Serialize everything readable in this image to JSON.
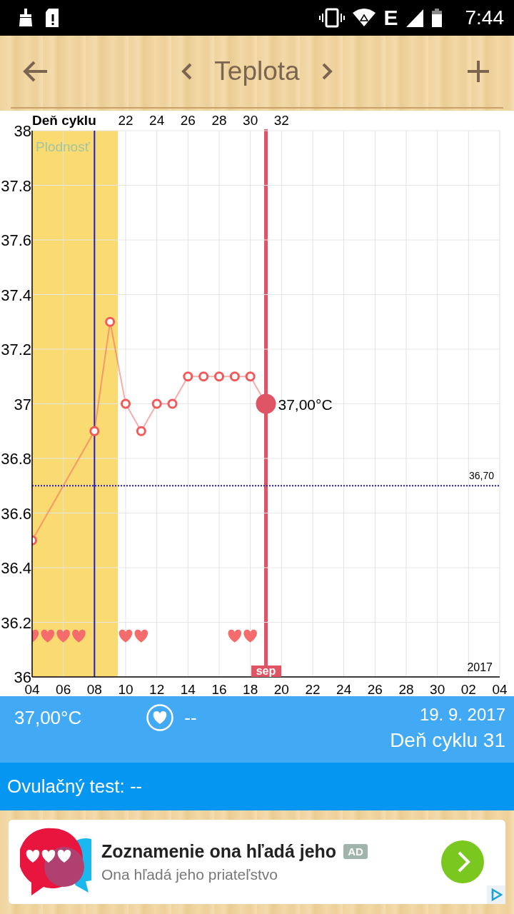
{
  "status_bar": {
    "network": "E",
    "time": "7:44"
  },
  "header": {
    "title": "Teplota"
  },
  "chart": {
    "cycle_axis_title": "Deň cyklu",
    "fertility_label": "Plodnosť",
    "year": "2017",
    "month": "sep",
    "cycle_labels": [
      "22",
      "24",
      "26",
      "28",
      "30",
      "32"
    ],
    "chart_data": {
      "type": "line",
      "grid": true,
      "categories": [
        "04",
        null,
        "06",
        null,
        "08",
        null,
        "10",
        null,
        "12",
        null,
        "14",
        null,
        "16",
        null,
        "18",
        null,
        "20",
        null,
        "22",
        null,
        "24",
        null,
        "26",
        null,
        "28",
        null,
        "30",
        null,
        "02",
        null,
        "04"
      ],
      "series": [
        {
          "color": "#f25a5a",
          "marker": "circle",
          "values": [
            36.5,
            null,
            null,
            null,
            36.9,
            37.3,
            37.0,
            36.9,
            37.0,
            37.0,
            37.1,
            37.1,
            37.1,
            37.1,
            37.1,
            37.0,
            null,
            null,
            null,
            null,
            null,
            null,
            null,
            null,
            null,
            null,
            null,
            null,
            null,
            null,
            null
          ]
        },
        {
          "type": "scatter",
          "color": "#f56c6c",
          "values": [
            36.15,
            36.15,
            36.15,
            36.15,
            null,
            null,
            36.15,
            36.15,
            null,
            null,
            null,
            null,
            null,
            36.15,
            36.15,
            null,
            null,
            null,
            null,
            null,
            null,
            null,
            null,
            null,
            null,
            null,
            null,
            null,
            null,
            null,
            null
          ]
        }
      ],
      "ylim": [
        36,
        38
      ],
      "yticks": [
        36,
        36.2,
        36.4,
        36.6,
        36.8,
        37,
        37.2,
        37.4,
        37.6,
        37.8,
        38
      ],
      "ref_lines": [
        {
          "axis": "x",
          "value": "08",
          "color": "#1c1cc8"
        },
        {
          "axis": "y",
          "value": 36.7,
          "color": "#1c1cc8",
          "label": "36,70"
        }
      ],
      "annotations": [
        "37,00°C"
      ]
    }
  },
  "summary": {
    "temperature": "37,00°C",
    "intercourse": "--",
    "date": "19. 9. 2017",
    "cycle_day": "Deň cyklu 31"
  },
  "ovulation_test": {
    "text": "Ovulačný test: --"
  },
  "ad": {
    "title": "Zoznamenie ona hľadá jeho",
    "badge": "AD",
    "subtitle": "Ona hľadá jeho priateľstvo"
  }
}
